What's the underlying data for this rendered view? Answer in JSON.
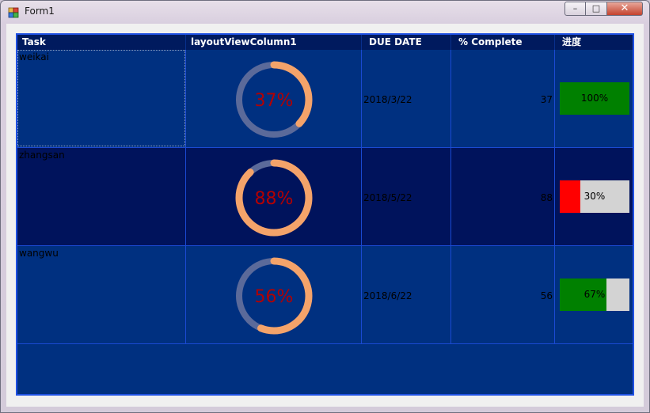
{
  "window": {
    "title": "Form1",
    "controls": {
      "minimize": "–",
      "maximize": "□",
      "close": "✕"
    }
  },
  "colors": {
    "ring_track": "#5b6a9a",
    "ring_progress": "#f4a36a",
    "ring_text": "#b40000",
    "bar_green": "#008000",
    "bar_red": "#ff0000",
    "bar_bg": "#d3d3d3"
  },
  "grid": {
    "headers": [
      "Task",
      "layoutViewColumn1",
      "DUE DATE",
      "% Complete",
      "进度"
    ],
    "rows": [
      {
        "task": "weikai",
        "ring_label": "37%",
        "ring_value": 37,
        "due_date": "2018/3/22",
        "percent": "37",
        "progress_label": "100%",
        "progress_value": 1.0,
        "progress_color": "#008000"
      },
      {
        "task": "zhangsan",
        "ring_label": "88%",
        "ring_value": 88,
        "due_date": "2018/5/22",
        "percent": "88",
        "progress_label": "30%",
        "progress_value": 0.3,
        "progress_color": "#ff0000"
      },
      {
        "task": "wangwu",
        "ring_label": "56%",
        "ring_value": 56,
        "due_date": "2018/6/22",
        "percent": "56",
        "progress_label": "67%",
        "progress_value": 0.67,
        "progress_color": "#008000"
      }
    ]
  }
}
